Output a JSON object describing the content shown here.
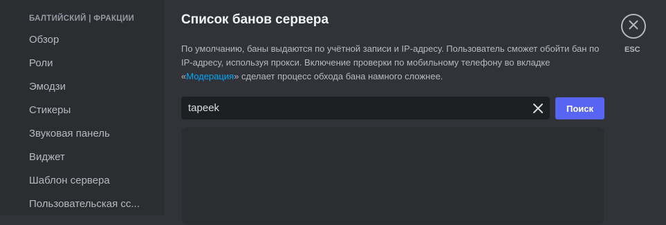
{
  "sidebar": {
    "section_header": "БАЛТИЙСКИЙ | ФРАКЦИИ",
    "items": [
      {
        "label": "Обзор"
      },
      {
        "label": "Роли"
      },
      {
        "label": "Эмодзи"
      },
      {
        "label": "Стикеры"
      },
      {
        "label": "Звуковая панель"
      },
      {
        "label": "Виджет"
      },
      {
        "label": "Шаблон сервера"
      },
      {
        "label": "Пользовательская сс..."
      }
    ]
  },
  "main": {
    "title": "Список банов сервера",
    "description": {
      "part1": "По умолчанию, баны выдаются по учётной записи и IP-адресу. Пользователь сможет обойти бан по IP-адресу, используя прокси. Включение проверки по мобильному телефону во вкладке «",
      "link": "Модерация",
      "part2": "» сделает процесс обхода бана намного сложнее."
    },
    "search": {
      "value": "tapeek",
      "clear_icon": "close-icon",
      "button_label": "Поиск"
    }
  },
  "close": {
    "icon": "close-circle-icon",
    "label": "ESC"
  },
  "colors": {
    "background": "#313338",
    "sidebar": "#2b2d31",
    "accent": "#5865f2",
    "link": "#00a8fc"
  }
}
